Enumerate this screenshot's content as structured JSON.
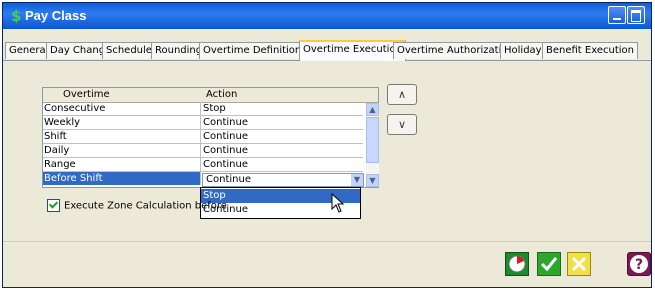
{
  "window": {
    "title": "Pay Class",
    "app_icon_glyph": "$",
    "colors": {
      "titlebar": "#0a58d0",
      "selection": "#316ac5",
      "tab_accent": "#ffc73c"
    }
  },
  "tabs": [
    {
      "label": "General",
      "active": false
    },
    {
      "label": "Day Change",
      "active": false
    },
    {
      "label": "Schedule",
      "active": false
    },
    {
      "label": "Rounding",
      "active": false
    },
    {
      "label": "Overtime Definition",
      "active": false
    },
    {
      "label": "Overtime Execution",
      "active": true
    },
    {
      "label": "Overtime Authorization",
      "active": false
    },
    {
      "label": "Holiday",
      "active": false
    },
    {
      "label": "Benefit Execution",
      "active": false
    }
  ],
  "table": {
    "columns": [
      "Overtime",
      "Action"
    ],
    "rows": [
      {
        "overtime": "Consecutive",
        "action": "Stop"
      },
      {
        "overtime": "Weekly",
        "action": "Continue"
      },
      {
        "overtime": "Shift",
        "action": "Continue"
      },
      {
        "overtime": "Daily",
        "action": "Continue"
      },
      {
        "overtime": "Range",
        "action": "Continue"
      },
      {
        "overtime": "Before Shift",
        "action": "Continue",
        "selected": true
      }
    ]
  },
  "dropdown": {
    "selected": "Continue",
    "options": [
      "Stop",
      "Continue"
    ],
    "highlighted": "Stop"
  },
  "checkbox": {
    "label": "Execute Zone Calculation before",
    "checked": true
  },
  "footer_buttons": [
    {
      "name": "clock-icon"
    },
    {
      "name": "ok-icon"
    },
    {
      "name": "cancel-icon"
    },
    {
      "name": "help-icon"
    }
  ]
}
